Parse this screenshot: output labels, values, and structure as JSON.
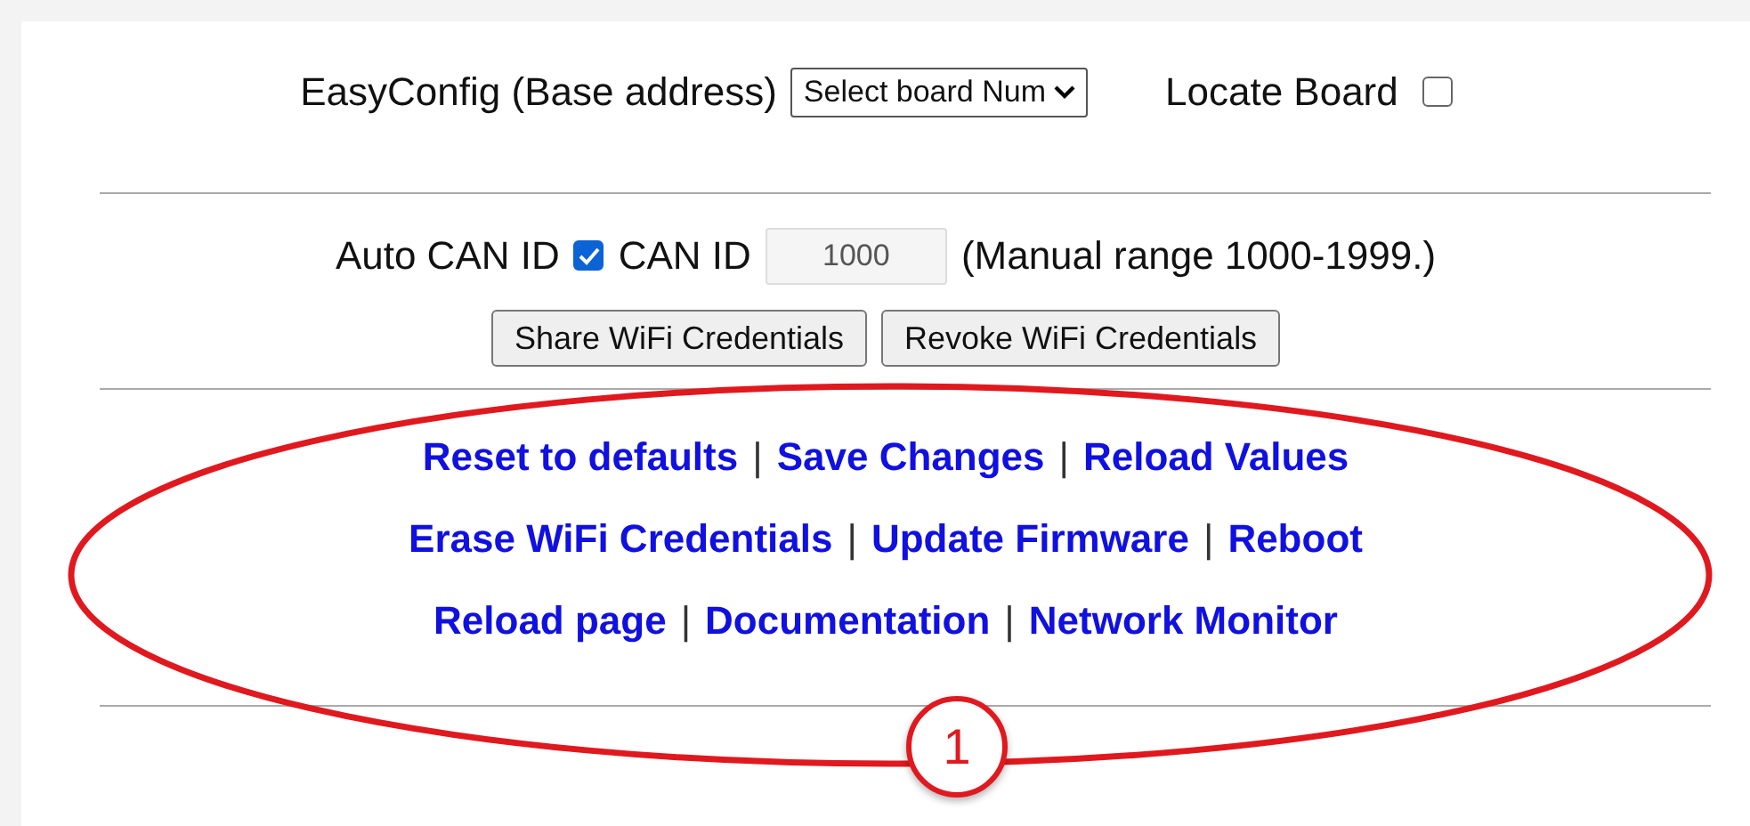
{
  "easy_config": {
    "label": "EasyConfig (Base address)",
    "select_value": "Select board Num",
    "locate_label": "Locate Board",
    "locate_checked": false
  },
  "can": {
    "auto_label": "Auto CAN ID",
    "auto_checked": true,
    "id_label": "CAN ID",
    "id_value": "1000",
    "range_note": "(Manual range 1000-1999.)"
  },
  "wifi_buttons": [
    "Share WiFi Credentials",
    "Revoke WiFi Credentials"
  ],
  "link_rows": [
    [
      "Reset to defaults",
      "Save Changes",
      "Reload Values"
    ],
    [
      "Erase WiFi Credentials",
      "Update Firmware",
      "Reboot"
    ],
    [
      "Reload page",
      "Documentation",
      "Network Monitor"
    ]
  ],
  "separator": "|",
  "annotation": {
    "number": "1"
  }
}
